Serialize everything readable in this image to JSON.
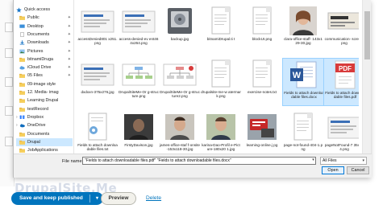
{
  "nav": {
    "items": [
      {
        "label": "Quick access",
        "icon": "star-icon",
        "pin": false,
        "level": 0
      },
      {
        "label": "Public",
        "icon": "folder-icon",
        "pin": true,
        "level": 1
      },
      {
        "label": "Desktop",
        "icon": "desktop-icon",
        "pin": true,
        "level": 1
      },
      {
        "label": "Documents",
        "icon": "documents-icon",
        "pin": true,
        "level": 1
      },
      {
        "label": "Downloads",
        "icon": "downloads-icon",
        "pin": true,
        "level": 1
      },
      {
        "label": "Pictures",
        "icon": "pictures-icon",
        "pin": true,
        "level": 1
      },
      {
        "label": "bitnamiDruga",
        "icon": "folder-icon",
        "pin": true,
        "level": 1
      },
      {
        "label": "iCloud Drive",
        "icon": "cloud-icon",
        "pin": true,
        "level": 1
      },
      {
        "label": "05 Files",
        "icon": "folder-icon",
        "pin": true,
        "level": 1
      },
      {
        "label": "09-image style",
        "icon": "folder-icon",
        "pin": false,
        "level": 1
      },
      {
        "label": "12. Media- imag",
        "icon": "folder-icon",
        "pin": false,
        "level": 1
      },
      {
        "label": "Learning Drupal",
        "icon": "folder-icon",
        "pin": false,
        "level": 1
      },
      {
        "label": "testRecord",
        "icon": "folder-icon",
        "pin": false,
        "level": 1
      },
      {
        "label": "Dropbox",
        "icon": "dropbox-icon",
        "pin": false,
        "level": 0
      },
      {
        "label": "OneDrive",
        "icon": "onedrive-icon",
        "pin": false,
        "level": 0
      },
      {
        "label": "Documents",
        "icon": "folder-icon",
        "pin": false,
        "level": 1
      },
      {
        "label": "Drupal",
        "icon": "folder-icon",
        "pin": false,
        "level": 1,
        "selected": true
      },
      {
        "label": "JobApplications",
        "icon": "folder-icon",
        "pin": false,
        "level": 1
      }
    ]
  },
  "files": [
    {
      "label": "accessDenied801 x251.png",
      "kind": "screenshot"
    },
    {
      "label": "access-denied-ev ent464x264.png",
      "kind": "screenshot"
    },
    {
      "label": "backup.jpg",
      "kind": "disk"
    },
    {
      "label": "bitnamiDrupal.ti t",
      "kind": "doc"
    },
    {
      "label": "blockUI.png",
      "kind": "doc"
    },
    {
      "label": "clara-office-staff- 143x129-30.jpg",
      "kind": "photo-woman"
    },
    {
      "label": "communication- screen.png",
      "kind": "banner"
    },
    {
      "label": "dxdxxn-375x276.jpg",
      "kind": "screenshot"
    },
    {
      "label": "DrupalSiteMe-Or g-structure.png",
      "kind": "diagram"
    },
    {
      "label": "DrupalSiteMe-Or g-structure2.png",
      "kind": "diagram-red"
    },
    {
      "label": "drupalsite-me-w atermark.png",
      "kind": "doc"
    },
    {
      "label": "exercise-notes.txt",
      "kind": "doc"
    },
    {
      "label": "Fields to attach downloadable files.docx",
      "kind": "word",
      "selected": true
    },
    {
      "label": "Fields to attach downloadable files.pdf",
      "kind": "pdf",
      "selected": true
    },
    {
      "label": "Fields to attach downloadable files.txt",
      "kind": "doc-gear"
    },
    {
      "label": "FirstyDavison.jpg",
      "kind": "photo-dark"
    },
    {
      "label": "james-office-staf f-onsite-153x118-30.jpg",
      "kind": "photo-man"
    },
    {
      "label": "karina-Dao-Profil e-Picture-180x20 1.jpg",
      "kind": "photo-man2"
    },
    {
      "label": "learning-online.j pg",
      "kind": "photo-red"
    },
    {
      "label": "page-not-found-404-1.png",
      "kind": "doc"
    },
    {
      "label": "pageNotFound-7 35x234.png",
      "kind": "screenshot"
    }
  ],
  "footer": {
    "filename_label": "File name:",
    "filename_value": "\"Fields to attach downloadable files.pdf\" \"Fields to attach downloadable files.docx\"",
    "filetype_value": "All Files",
    "open_label": "Open",
    "cancel_label": "Cancel"
  },
  "page": {
    "save_label": "Save and keep published",
    "preview_label": "Preview",
    "delete_label": "Delete",
    "watermark_text": "DrupalSite.Me"
  },
  "colors": {
    "selection": "#cce8ff",
    "accent": "#0074bd",
    "word_blue": "#2b579a",
    "pdf_red": "#d83b3b"
  }
}
